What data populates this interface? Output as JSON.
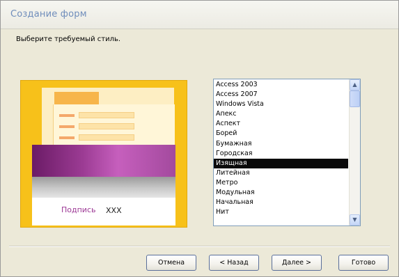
{
  "window": {
    "title": "Создание форм"
  },
  "prompt": "Выберите требуемый стиль.",
  "preview": {
    "label": "Подпись",
    "value": "XXX"
  },
  "styles": {
    "items": [
      "Access 2003",
      "Access 2007",
      "Windows Vista",
      "Апекс",
      "Аспект",
      "Борей",
      "Бумажная",
      "Городская",
      "Изящная",
      "Литейная",
      "Метро",
      "Модульная",
      "Начальная",
      "Нит"
    ],
    "selected": "Изящная"
  },
  "buttons": {
    "cancel": "Отмена",
    "back": "< Назад",
    "next": "Далее >",
    "finish": "Готово"
  },
  "colors": {
    "selection": "#0a0a0a",
    "preview_background": "#f7c11a",
    "preview_band": "#9b3b93",
    "title_text": "#6f8dbb"
  }
}
